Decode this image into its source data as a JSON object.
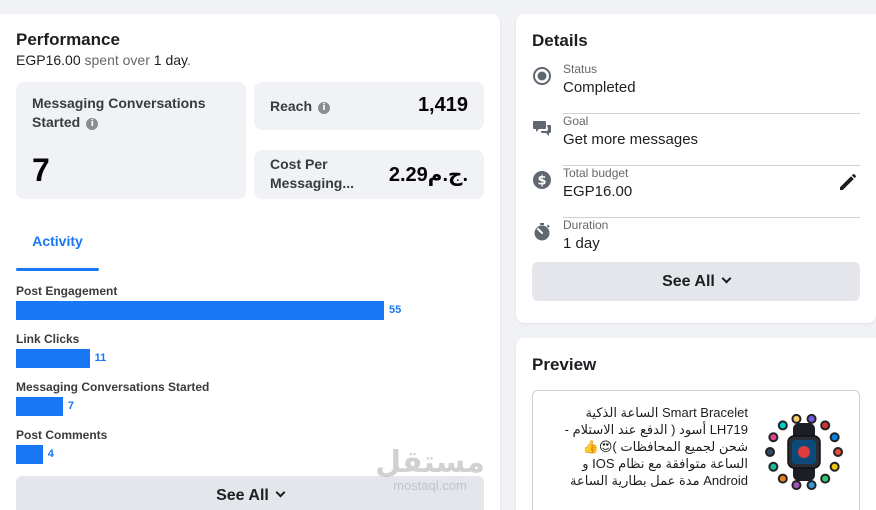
{
  "performance": {
    "title": "Performance",
    "spent_amount": "EGP16.00",
    "spent_mid": " spent over ",
    "spent_days": "1 day",
    "spent_end": ".",
    "metrics": {
      "messaging": {
        "label": "Messaging Conversations Started",
        "value": "7"
      },
      "reach": {
        "label": "Reach",
        "value": "1,419"
      },
      "cost": {
        "label": "Cost Per Messaging...",
        "value": "2.29ج.م."
      }
    },
    "tab_label": "Activity",
    "activity": [
      {
        "label": "Post Engagement",
        "value": 55
      },
      {
        "label": "Link Clicks",
        "value": 11
      },
      {
        "label": "Messaging Conversations Started",
        "value": 7
      },
      {
        "label": "Post Comments",
        "value": 4
      }
    ],
    "see_all_label": "See All"
  },
  "details": {
    "title": "Details",
    "rows": [
      {
        "label": "Status",
        "value": "Completed",
        "icon": "radio-status-icon"
      },
      {
        "label": "Goal",
        "value": "Get more messages",
        "icon": "chat-bubbles-icon"
      },
      {
        "label": "Total budget",
        "value": "EGP16.00",
        "icon": "dollar-circle-icon"
      },
      {
        "label": "Duration",
        "value": "1 day",
        "icon": "stopwatch-icon"
      }
    ],
    "see_all_label": "See All"
  },
  "preview": {
    "title": "Preview",
    "ad_text": "Smart Bracelet الساعة الذكية LH719 أسود ( الدفع عند الاستلام - شحن لجميع المحافظات )😍👍 الساعة متوافقة مع نظام IOS و Android مدة عمل بطارية الساعة"
  },
  "watermark": {
    "main": "مستقل",
    "sub": "mostaql.com"
  },
  "colors": {
    "accent": "#1877f2",
    "card_bg": "#ffffff",
    "page_bg": "#f0f2f5",
    "metric_bg": "#f0f2f5"
  }
}
